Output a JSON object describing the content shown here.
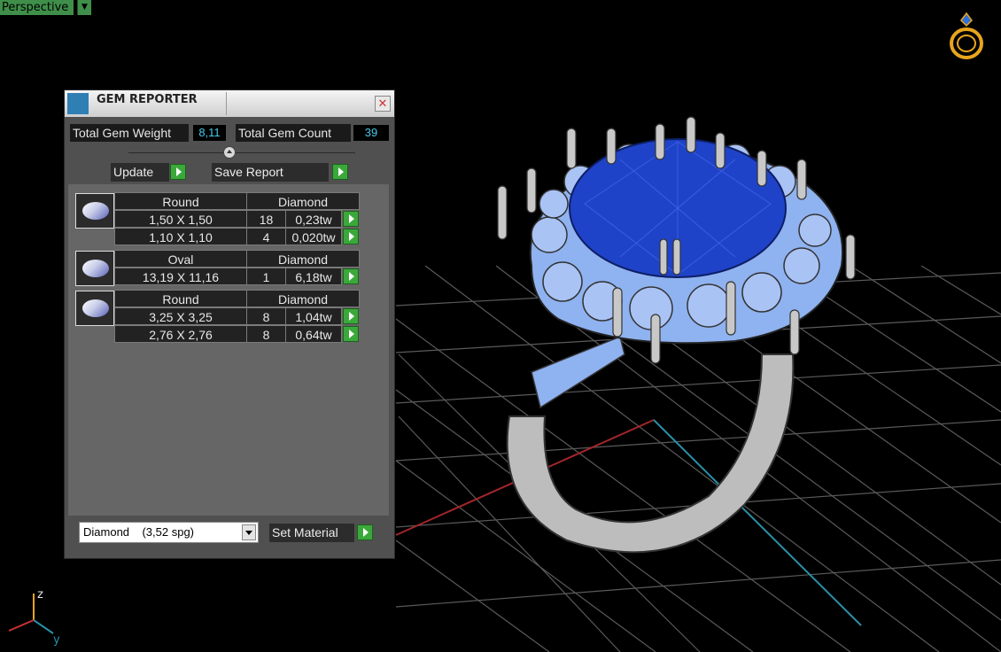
{
  "viewport": {
    "label": "Perspective",
    "axis_labels": {
      "z": "z",
      "y": "y"
    },
    "colors": {
      "grid": "#5a5a5a",
      "axis_x": "#a3262b",
      "axis_y": "#2a8fa6",
      "gem": "#1f43c8",
      "side_stones": "#8fb2f0",
      "metal": "#c4c4c4"
    }
  },
  "panel": {
    "title": "GEM REPORTER",
    "close": "✕",
    "total_weight_label": "Total Gem Weight",
    "total_weight_value": "8,11",
    "total_count_label": "Total Gem Count",
    "total_count_value": "39",
    "update_label": "Update",
    "save_report_label": "Save Report",
    "groups": [
      {
        "shape": "Round",
        "type": "Diamond",
        "rows": [
          {
            "size": "1,50 X 1,50",
            "count": "18",
            "weight": "0,23tw"
          },
          {
            "size": "1,10 X 1,10",
            "count": "4",
            "weight": "0,020tw"
          }
        ]
      },
      {
        "shape": "Oval",
        "type": "Diamond",
        "rows": [
          {
            "size": "13,19 X 11,16",
            "count": "1",
            "weight": "6,18tw"
          }
        ]
      },
      {
        "shape": "Round",
        "type": "Diamond",
        "rows": [
          {
            "size": "3,25 X 3,25",
            "count": "8",
            "weight": "1,04tw"
          },
          {
            "size": "2,76 X 2,76",
            "count": "8",
            "weight": "0,64tw"
          }
        ]
      }
    ],
    "material_select": "Diamond    (3,52 spg)",
    "set_material_label": "Set Material"
  }
}
